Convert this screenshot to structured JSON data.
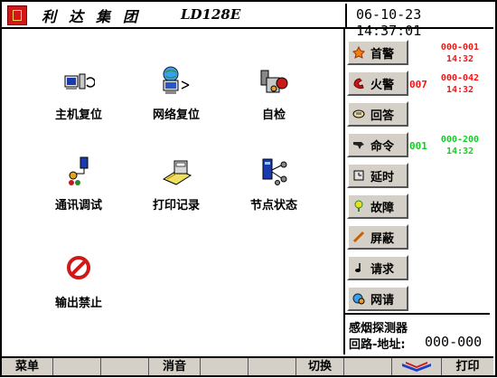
{
  "header": {
    "brand": "利达集团",
    "model": "LD128E",
    "datetime": "06-10-23 14:37:01"
  },
  "main": {
    "tiles": [
      {
        "label": "主机复位",
        "icon": "computer-reset-icon"
      },
      {
        "label": "网络复位",
        "icon": "network-reset-icon"
      },
      {
        "label": "自检",
        "icon": "self-test-icon"
      },
      {
        "label": "通讯调试",
        "icon": "communication-debug-icon"
      },
      {
        "label": "打印记录",
        "icon": "printer-icon"
      },
      {
        "label": "节点状态",
        "icon": "node-status-icon"
      },
      {
        "label": "输出禁止",
        "icon": "prohibited-icon"
      }
    ]
  },
  "right": {
    "items": [
      {
        "label": "首警",
        "icon": "first-alarm-icon"
      },
      {
        "label": "火警",
        "icon": "fire-alarm-icon"
      },
      {
        "label": "回答",
        "icon": "answer-icon"
      },
      {
        "label": "命令",
        "icon": "command-icon"
      },
      {
        "label": "延时",
        "icon": "delay-icon"
      },
      {
        "label": "故障",
        "icon": "fault-icon"
      },
      {
        "label": "屏蔽",
        "icon": "shield-icon"
      },
      {
        "label": "请求",
        "icon": "request-icon"
      },
      {
        "label": "网请",
        "icon": "network-request-icon"
      }
    ],
    "first_alarm": {
      "range": "000-001",
      "time": "14:32"
    },
    "fire_alarm": {
      "count": "007",
      "range": "000-042",
      "time": "14:32"
    },
    "command": {
      "count": "001",
      "range": "000-200",
      "time": "14:32"
    }
  },
  "detector": {
    "name": "感烟探测器",
    "addr_label": "回路-地址:",
    "addr_value": "000-000"
  },
  "footer": {
    "menu": "菜单",
    "silence": "消音",
    "switch": "切换",
    "print": "打印"
  },
  "colors": {
    "alarm": "#ff1010",
    "ok": "#10d020",
    "button": "#d4d0c8",
    "logo": "#d01818"
  }
}
